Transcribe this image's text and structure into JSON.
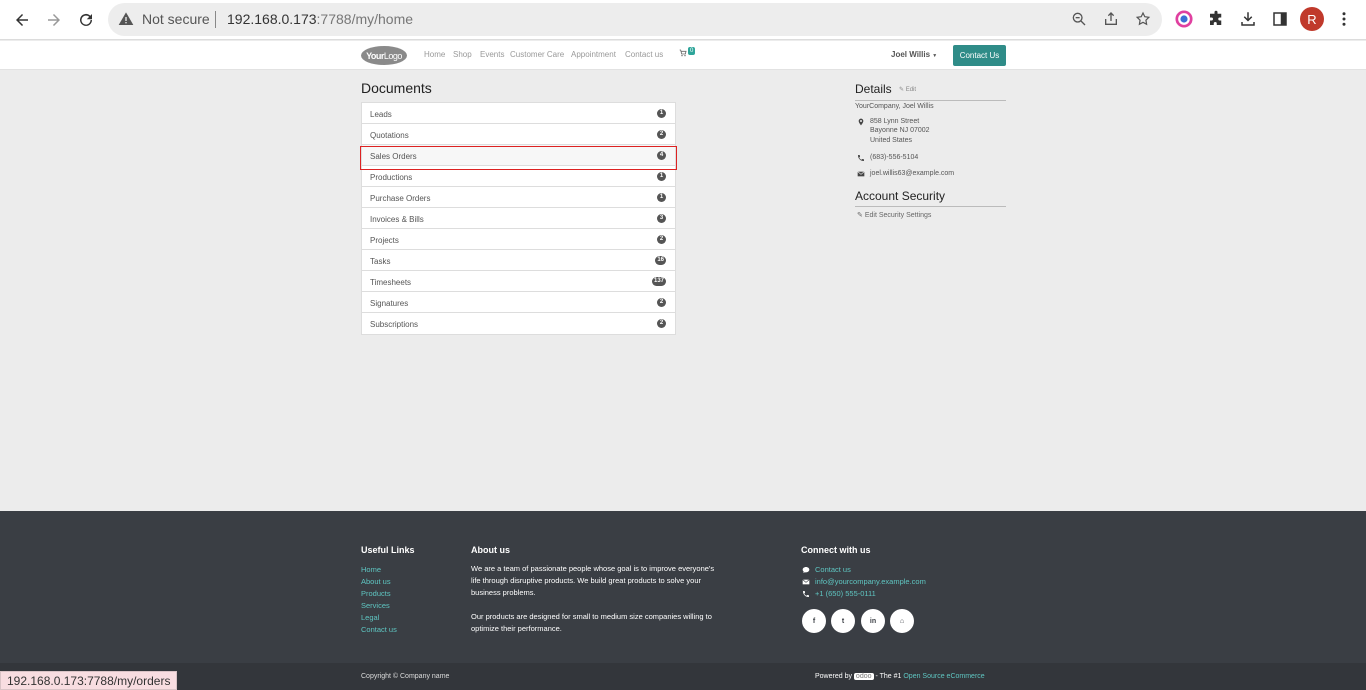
{
  "browser": {
    "security_label": "Not secure",
    "url_host": "192.168.0.173",
    "url_path": ":7788/my/home",
    "profile_initial": "R",
    "status_url": "192.168.0.173:7788/my/orders"
  },
  "header": {
    "logo_bold": "Your",
    "logo_light": "Logo",
    "menu": [
      "Home",
      "Shop",
      "Events",
      "Customer Care",
      "Appointment",
      "Contact us"
    ],
    "cart_count": "0",
    "user_name": "Joel Willis",
    "contact_button": "Contact Us"
  },
  "documents": {
    "title": "Documents",
    "items": [
      {
        "label": "Leads",
        "count": "1"
      },
      {
        "label": "Quotations",
        "count": "2"
      },
      {
        "label": "Sales Orders",
        "count": "4"
      },
      {
        "label": "Productions",
        "count": "1"
      },
      {
        "label": "Purchase Orders",
        "count": "1"
      },
      {
        "label": "Invoices & Bills",
        "count": "3"
      },
      {
        "label": "Projects",
        "count": "2"
      },
      {
        "label": "Tasks",
        "count": "16"
      },
      {
        "label": "Timesheets",
        "count": "137"
      },
      {
        "label": "Signatures",
        "count": "2"
      },
      {
        "label": "Subscriptions",
        "count": "2"
      }
    ]
  },
  "details": {
    "title": "Details",
    "edit_label": "Edit",
    "company_name": "YourCompany, Joel Willis",
    "address_line1": "858 Lynn Street",
    "address_line2": "Bayonne NJ 07002",
    "address_line3": "United States",
    "phone": "(683)-556-5104",
    "email": "joel.willis63@example.com"
  },
  "security": {
    "title": "Account Security",
    "link": "Edit Security Settings"
  },
  "footer": {
    "useful_links_title": "Useful Links",
    "useful_links": [
      "Home",
      "About us",
      "Products",
      "Services",
      "Legal",
      "Contact us"
    ],
    "about_title": "About us",
    "about_line1": "We are a team of passionate people whose goal is to improve everyone's",
    "about_line2": "life through disruptive products. We build great products to solve your",
    "about_line3": "business problems.",
    "about_line4": "Our products are designed for small to medium size companies willing to",
    "about_line5": "optimize their performance.",
    "connect_title": "Connect with us",
    "connect_contact": "Contact us",
    "connect_email": "info@yourcompany.example.com",
    "connect_phone": "+1 (650) 555-0111",
    "social": [
      "f",
      "t",
      "in",
      "⌂"
    ],
    "copyright": "Copyright © Company name",
    "powered_by": "Powered by",
    "odoo": "odoo",
    "powered_mid": "- The #1",
    "powered_link": "Open Source eCommerce"
  }
}
